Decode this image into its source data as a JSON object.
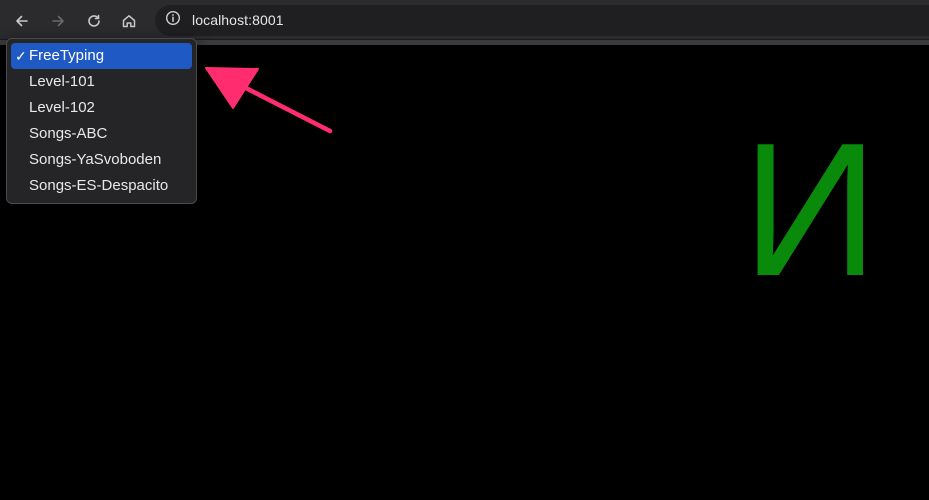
{
  "browser": {
    "url": "localhost:8001",
    "icons": {
      "back": "arrow-left-icon",
      "forward": "arrow-right-icon",
      "reload": "reload-icon",
      "home": "home-icon",
      "site_info": "info-icon"
    }
  },
  "dropdown": {
    "selected_index": 0,
    "check_mark": "✓",
    "options": [
      "FreeTyping",
      "Level-101",
      "Level-102",
      "Songs-ABC",
      "Songs-YaSvoboden",
      "Songs-ES-Despacito"
    ]
  },
  "content": {
    "glyph": "И",
    "glyph_color": "#0a8a0a",
    "background": "#000000"
  },
  "annotation": {
    "arrow_color": "#ff2d6f"
  }
}
